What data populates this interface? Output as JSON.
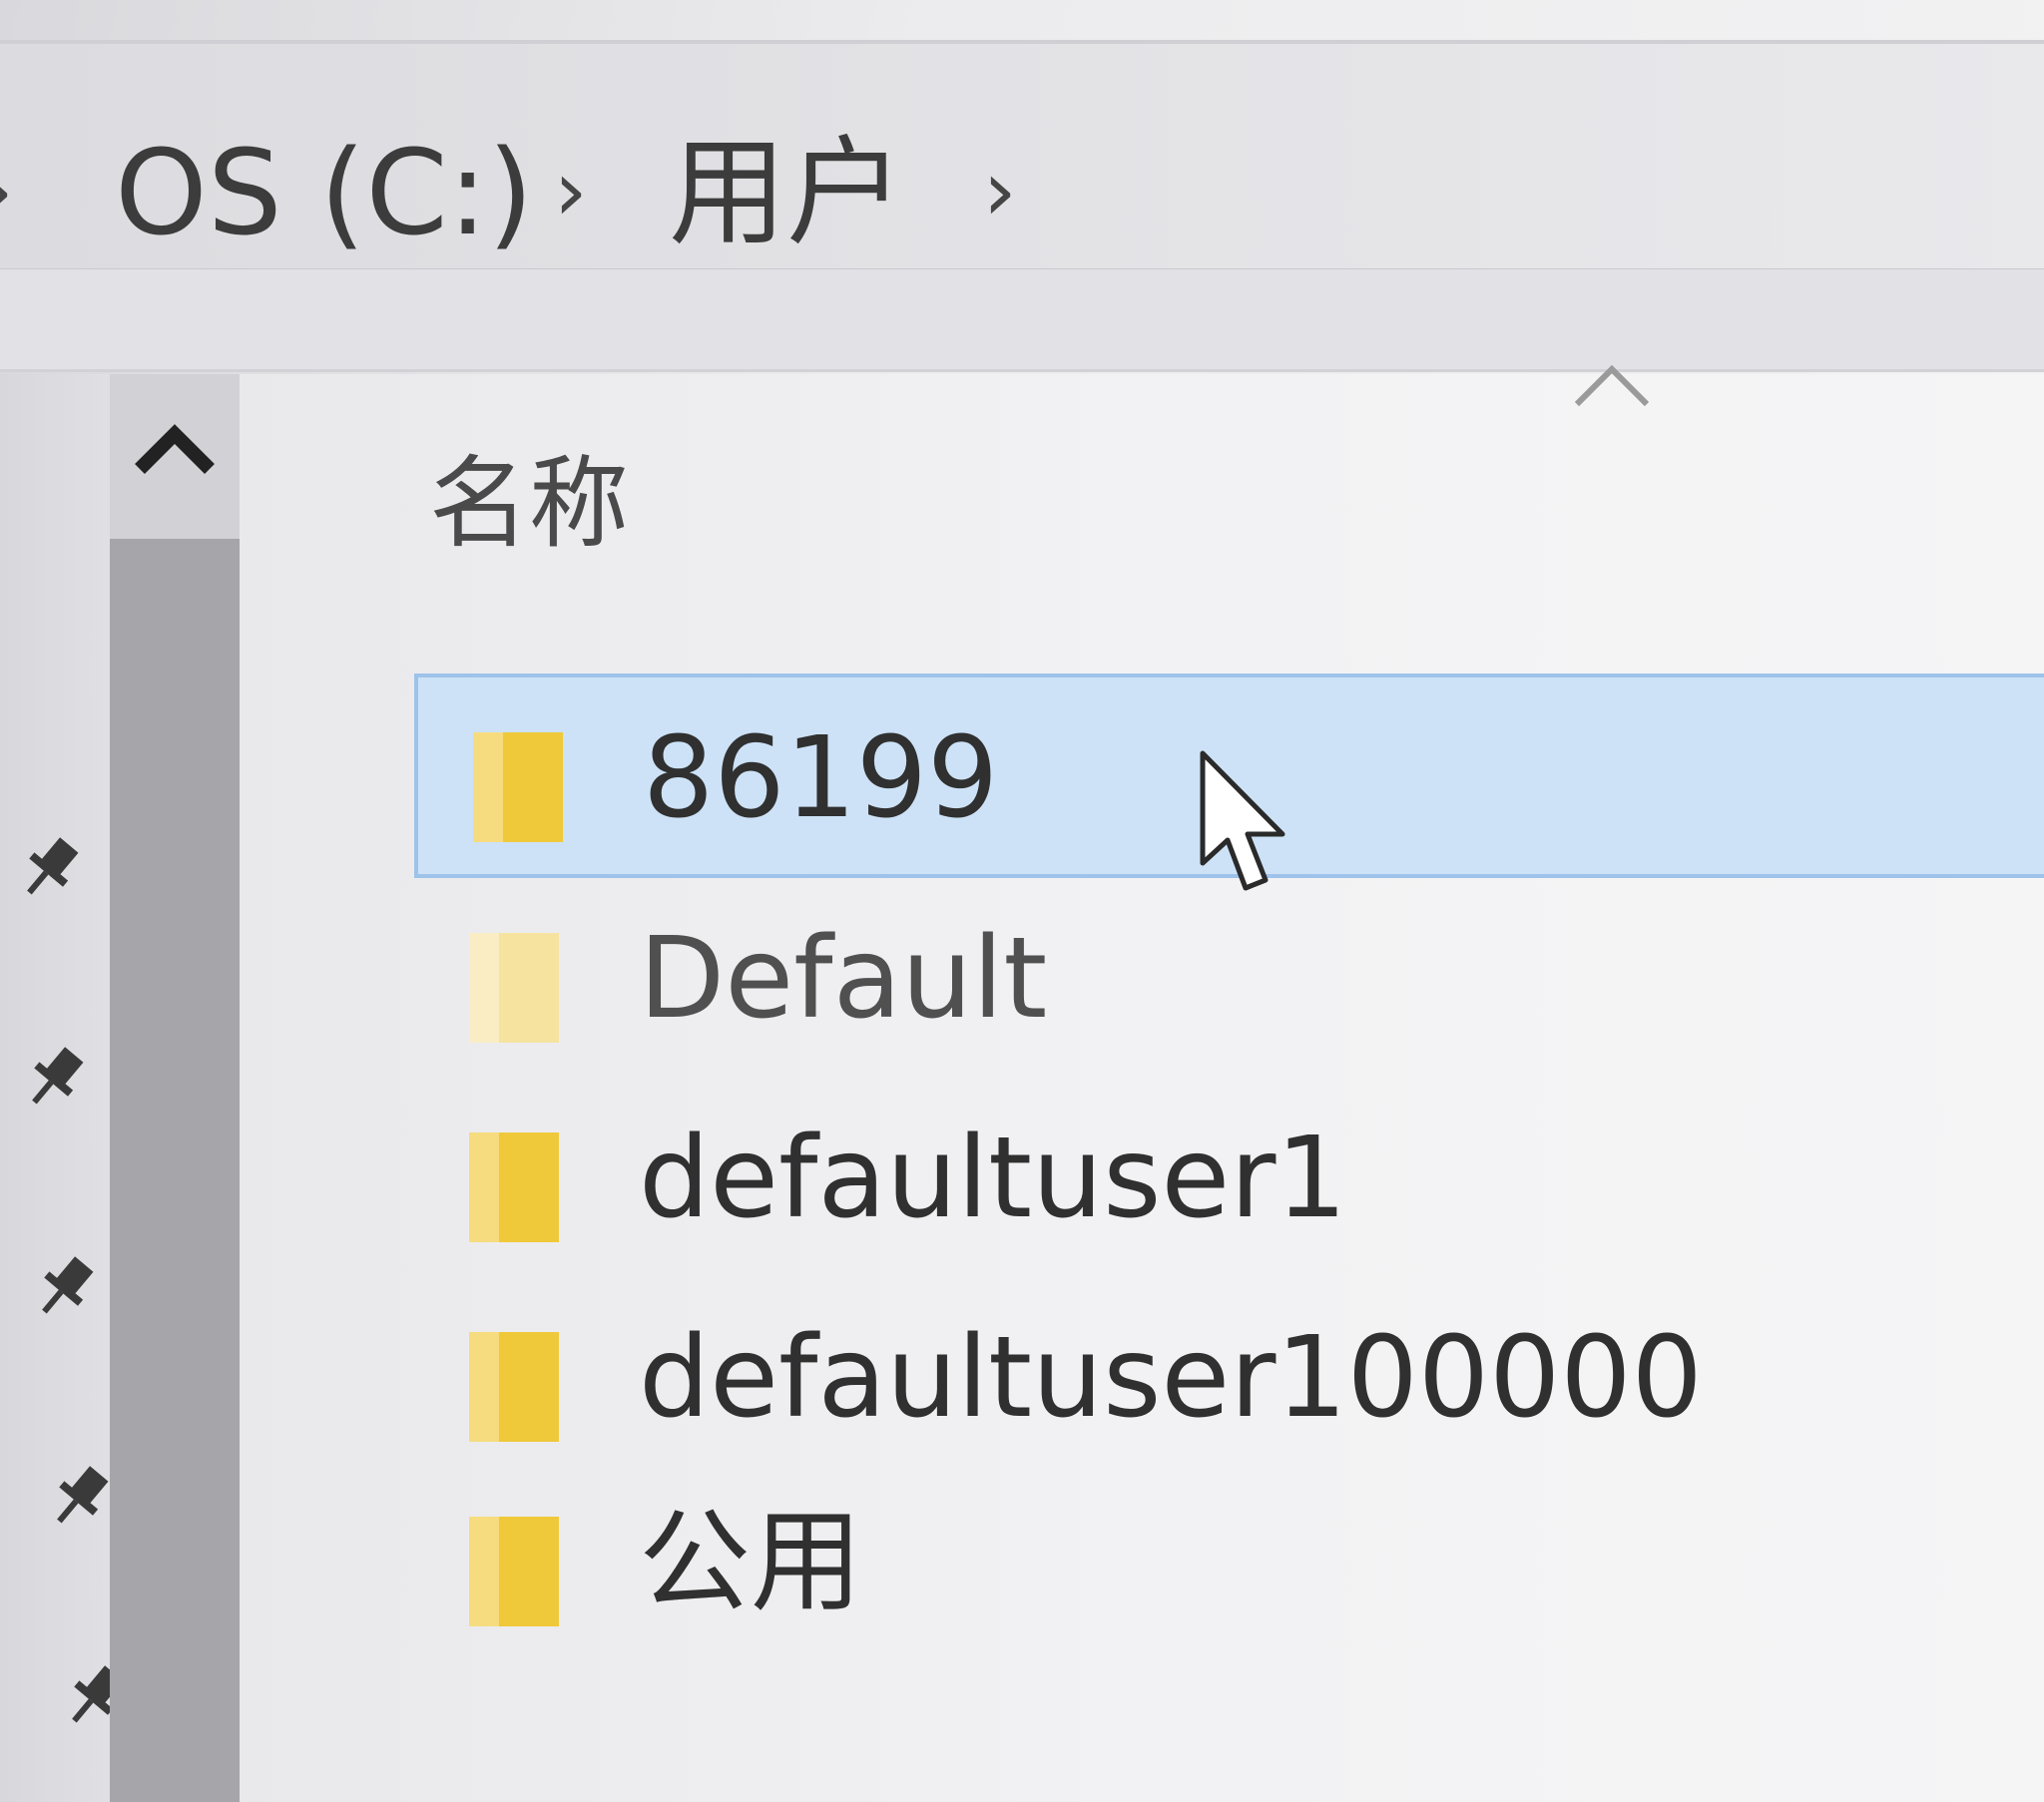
{
  "breadcrumb": {
    "items": [
      "OS (C:)",
      "用户"
    ],
    "separator": "›"
  },
  "file_list": {
    "column_header": "名称",
    "items": [
      {
        "name": "86199",
        "selected": true
      },
      {
        "name": "Default",
        "selected": false,
        "faded": true
      },
      {
        "name": "defaultuser1",
        "selected": false
      },
      {
        "name": "defaultuser100000",
        "selected": false
      },
      {
        "name": "公用",
        "selected": false
      }
    ]
  },
  "icons": {
    "folder": "folder-icon",
    "pin": "pin-icon",
    "scroll_up": "chevron-up-icon",
    "sort": "sort-ascending-icon",
    "cursor": "mouse-cursor-icon"
  },
  "colors": {
    "selection_fill": "#cde2f7",
    "selection_border": "#9ec3ea",
    "folder_yellow": "#f0c93a",
    "folder_light": "#f6dc7e"
  }
}
